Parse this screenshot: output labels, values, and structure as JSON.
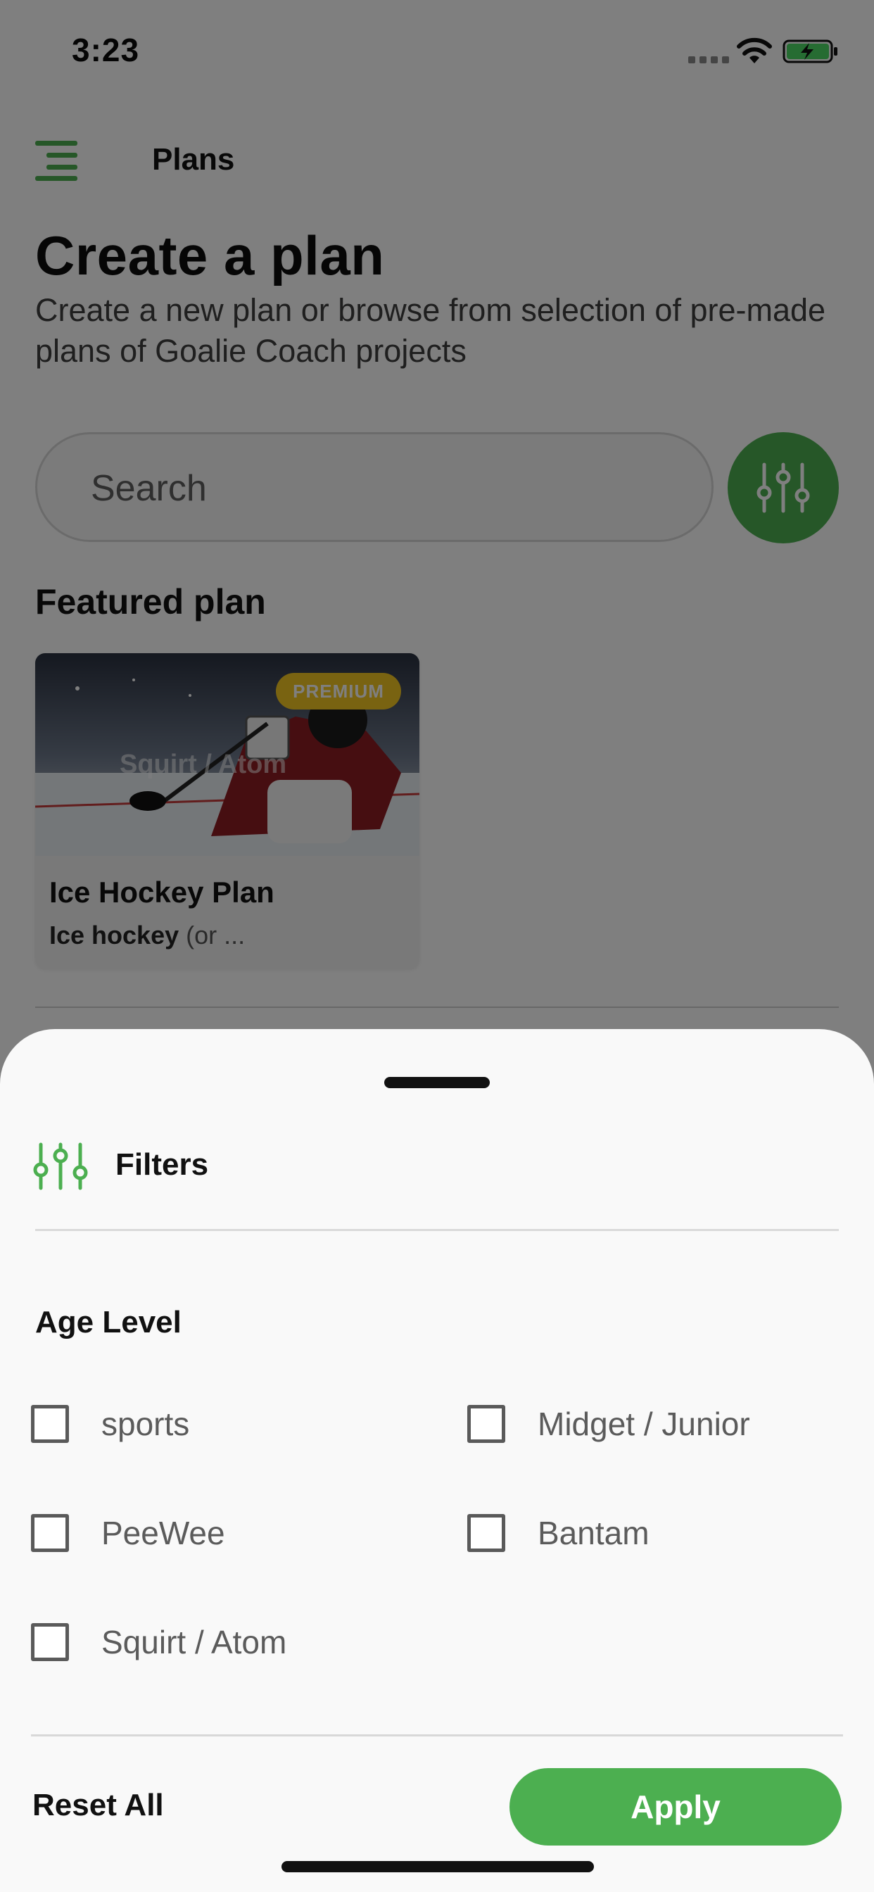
{
  "status_bar": {
    "time": "3:23"
  },
  "header": {
    "title": "Plans"
  },
  "page": {
    "title": "Create a plan",
    "subtitle": "Create a new plan or browse from selection of pre-made plans of Goalie Coach projects"
  },
  "search": {
    "placeholder": "Search"
  },
  "featured": {
    "section_title": "Featured plan",
    "card": {
      "badge": "PREMIUM",
      "name": "Ice Hockey Plan",
      "desc_bold": "Ice hockey",
      "desc_rest": " (or ..."
    }
  },
  "filters_sheet": {
    "title": "Filters",
    "age_level_title": "Age Level",
    "options": [
      {
        "label": "sports",
        "checked": false
      },
      {
        "label": "Midget / Junior",
        "checked": false
      },
      {
        "label": "PeeWee",
        "checked": false
      },
      {
        "label": "Bantam",
        "checked": false
      },
      {
        "label": "Squirt / Atom",
        "checked": false
      }
    ],
    "reset_label": "Reset All",
    "apply_label": "Apply"
  },
  "colors": {
    "accent": "#4caf50",
    "premium": "#f3c623",
    "overlay": "rgba(0,0,0,0.5)"
  },
  "icons": [
    "menu-icon",
    "filter-sliders-icon",
    "wifi-icon",
    "battery-charging-icon"
  ]
}
